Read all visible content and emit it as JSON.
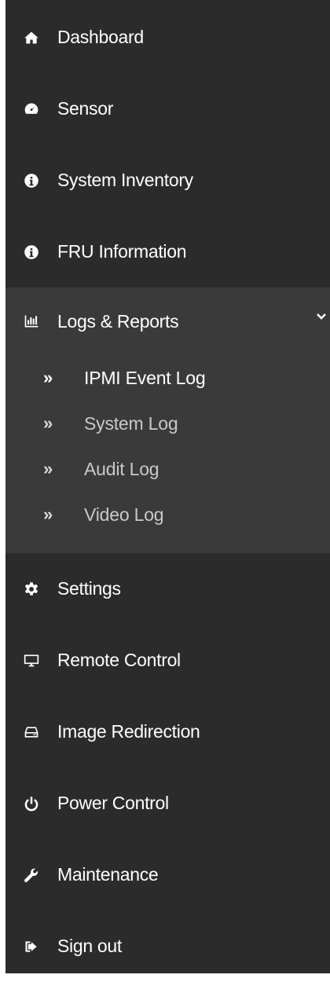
{
  "menu": {
    "items": [
      {
        "label": "Dashboard",
        "icon": "home-icon"
      },
      {
        "label": "Sensor",
        "icon": "gauge-icon"
      },
      {
        "label": "System Inventory",
        "icon": "info-icon"
      },
      {
        "label": "FRU Information",
        "icon": "info-icon"
      },
      {
        "label": "Logs & Reports",
        "icon": "bar-chart-icon",
        "expanded": true
      },
      {
        "label": "Settings",
        "icon": "gear-icon"
      },
      {
        "label": "Remote Control",
        "icon": "monitor-icon"
      },
      {
        "label": "Image Redirection",
        "icon": "hdd-icon"
      },
      {
        "label": "Power Control",
        "icon": "power-icon"
      },
      {
        "label": "Maintenance",
        "icon": "wrench-icon"
      },
      {
        "label": "Sign out",
        "icon": "sign-out-icon"
      }
    ],
    "logs_submenu": [
      {
        "bullet": "»",
        "label": "IPMI Event Log",
        "active": true
      },
      {
        "bullet": "»",
        "label": "System Log",
        "active": false
      },
      {
        "bullet": "»",
        "label": "Audit Log",
        "active": false
      },
      {
        "bullet": "»",
        "label": "Video Log",
        "active": false
      }
    ]
  },
  "colors": {
    "sidebar_bg": "#2b2b2b",
    "expanded_bg": "#3a3a3a",
    "text": "#ffffff",
    "subtext": "#c9c9c9"
  }
}
